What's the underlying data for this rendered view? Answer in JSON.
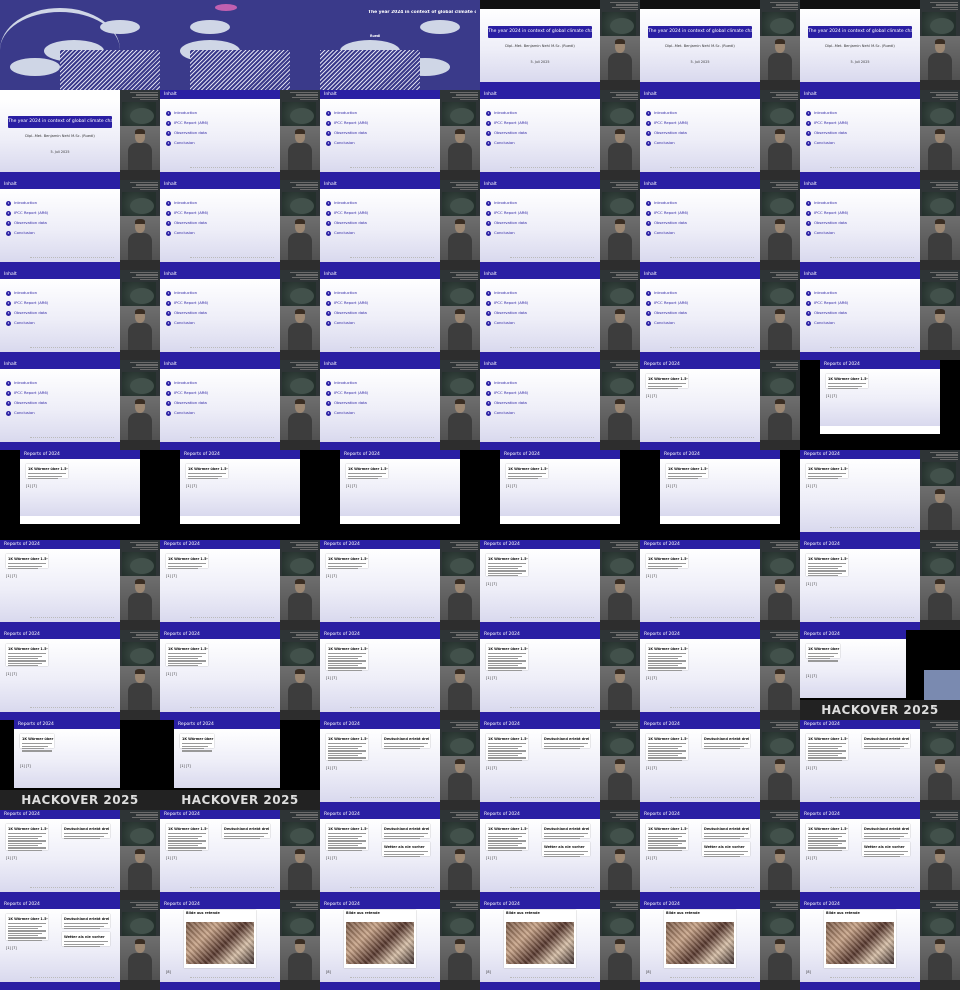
{
  "title_slide": {
    "title": "The year 2024 in context of global climate change",
    "author": "Dipl.-Met. Benjamin Nehl M.Sc. (Ruedi)",
    "date": "5. Juli 2025",
    "presenter_short": "Ruedi"
  },
  "toc": {
    "header": "Inhalt",
    "items": [
      "Introduction",
      "IPCC Report (AR6)",
      "Observation data",
      "Conclusion"
    ],
    "numbers": [
      "1",
      "2",
      "3",
      "4"
    ]
  },
  "reports": {
    "header": "Reports of 2024",
    "article1_headline": "1K Wärmer über 1.5-Grad",
    "article2_headline": "Deutschland erlebt drei warmen",
    "article3_headline": "Wetter als nie vorher",
    "article_photo_headline": "Bilde aus retende",
    "ref": "[1] [7]",
    "ref_single": "[8]"
  },
  "event": {
    "banner": "HACKOVER 2025"
  }
}
